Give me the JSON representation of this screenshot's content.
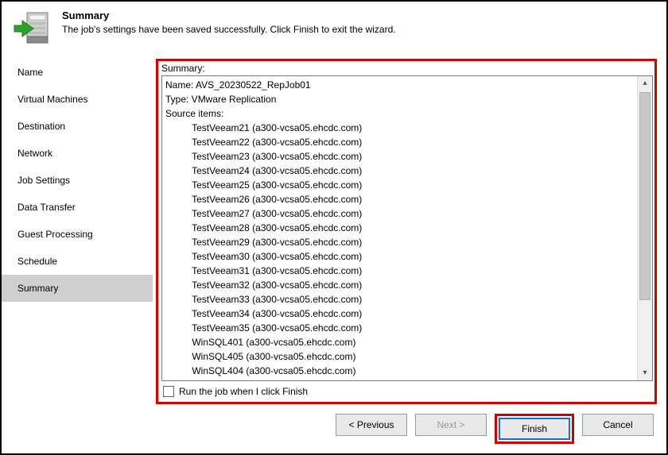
{
  "header": {
    "title": "Summary",
    "subtitle": "The job's settings have been saved successfully. Click Finish to exit the wizard."
  },
  "sidebar": {
    "items": [
      {
        "label": "Name",
        "active": false
      },
      {
        "label": "Virtual Machines",
        "active": false
      },
      {
        "label": "Destination",
        "active": false
      },
      {
        "label": "Network",
        "active": false
      },
      {
        "label": "Job Settings",
        "active": false
      },
      {
        "label": "Data Transfer",
        "active": false
      },
      {
        "label": "Guest Processing",
        "active": false
      },
      {
        "label": "Schedule",
        "active": false
      },
      {
        "label": "Summary",
        "active": true
      }
    ]
  },
  "summary": {
    "label": "Summary:",
    "name_line": "Name: AVS_20230522_RepJob01",
    "type_line": "Type: VMware Replication",
    "source_header": "Source items:",
    "items": [
      "TestVeeam21 (a300-vcsa05.ehcdc.com)",
      "TestVeeam22 (a300-vcsa05.ehcdc.com)",
      "TestVeeam23 (a300-vcsa05.ehcdc.com)",
      "TestVeeam24 (a300-vcsa05.ehcdc.com)",
      "TestVeeam25 (a300-vcsa05.ehcdc.com)",
      "TestVeeam26 (a300-vcsa05.ehcdc.com)",
      "TestVeeam27 (a300-vcsa05.ehcdc.com)",
      "TestVeeam28 (a300-vcsa05.ehcdc.com)",
      "TestVeeam29 (a300-vcsa05.ehcdc.com)",
      "TestVeeam30 (a300-vcsa05.ehcdc.com)",
      "TestVeeam31 (a300-vcsa05.ehcdc.com)",
      "TestVeeam32 (a300-vcsa05.ehcdc.com)",
      "TestVeeam33 (a300-vcsa05.ehcdc.com)",
      "TestVeeam34 (a300-vcsa05.ehcdc.com)",
      "TestVeeam35 (a300-vcsa05.ehcdc.com)",
      "WinSQL401 (a300-vcsa05.ehcdc.com)",
      "WinSQL405 (a300-vcsa05.ehcdc.com)",
      "WinSQL404 (a300-vcsa05.ehcdc.com)"
    ]
  },
  "runjob": {
    "label": "Run the job when I click Finish",
    "checked": false
  },
  "buttons": {
    "previous": "< Previous",
    "next": "Next >",
    "finish": "Finish",
    "cancel": "Cancel"
  }
}
